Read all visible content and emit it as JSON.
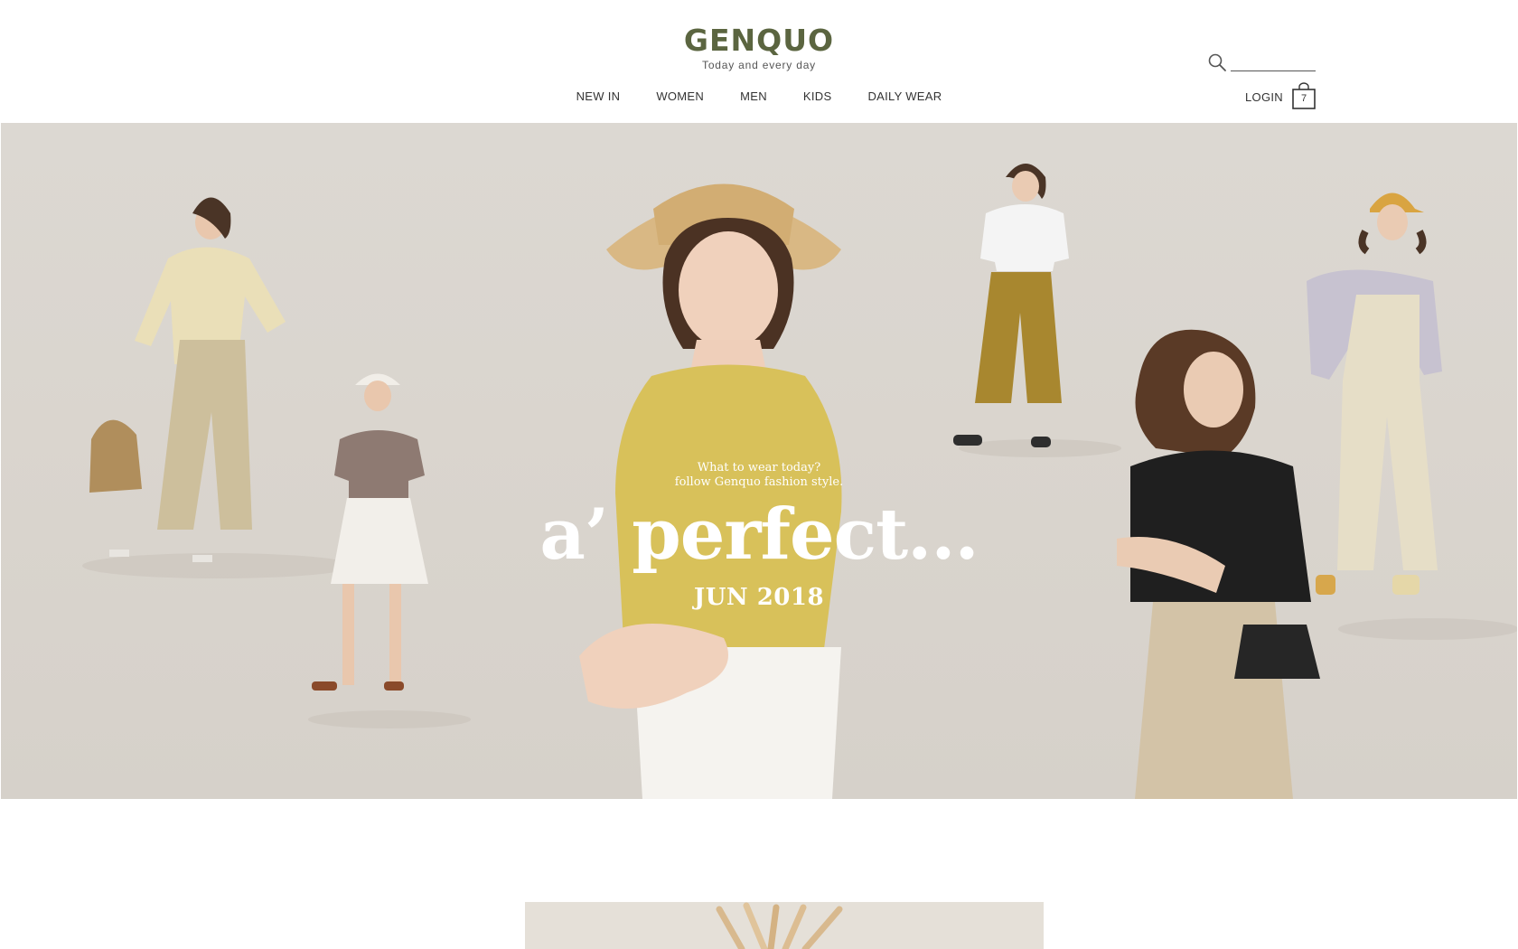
{
  "brand": {
    "name": "GENQUO",
    "tagline": "Today and every day",
    "accent_color": "#5b6540"
  },
  "nav": {
    "items": [
      {
        "label": "NEW IN"
      },
      {
        "label": "WOMEN"
      },
      {
        "label": "MEN"
      },
      {
        "label": "KIDS"
      },
      {
        "label": "DAILY WEAR"
      }
    ]
  },
  "account": {
    "login_label": "LOGIN",
    "cart_count": "7",
    "search_placeholder": ""
  },
  "icons": {
    "search": "search-icon",
    "cart": "shopping-bag-icon"
  },
  "hero": {
    "subtitle_line1": "What to wear today?",
    "subtitle_line2": "follow Genquo fashion style.",
    "title": "a’ perfect...",
    "date": "JUN 2018",
    "background_color": "#dcd8d2"
  }
}
